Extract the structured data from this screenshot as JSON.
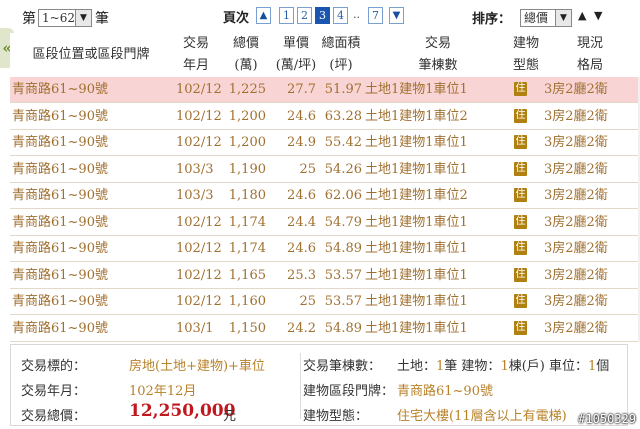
{
  "topbar": {
    "prefix": "第",
    "range_value": "1~62",
    "suffix": "筆",
    "page_label": "頁次",
    "pages": [
      "1",
      "2",
      "3",
      "4"
    ],
    "current_page": "3",
    "ellipsis": "..",
    "last_page": "7",
    "sort_label": "排序：",
    "sort_value": "總價"
  },
  "table": {
    "headers": {
      "location": "區段位置或區段門牌",
      "date_1": "交易",
      "date_2": "年月",
      "total_1": "總價",
      "total_2": "(萬)",
      "unit_1": "單價",
      "unit_2": "(萬/坪)",
      "area_1": "總面積",
      "area_2": "(坪)",
      "trans_1": "交易",
      "trans_2": "筆棟數",
      "btype_1": "建物",
      "btype_2": "型態",
      "layout_1": "現況",
      "layout_2": "格局"
    },
    "badge_text": "住",
    "rows": [
      {
        "loc": "青商路61~90號",
        "date": "102/12",
        "total": "1,225",
        "unit": "27.7",
        "area": "51.97",
        "trans": "土地1建物1車位1",
        "layout": "3房2廳2衛"
      },
      {
        "loc": "青商路61~90號",
        "date": "102/12",
        "total": "1,200",
        "unit": "24.6",
        "area": "63.28",
        "trans": "土地1建物1車位2",
        "layout": "3房2廳2衛"
      },
      {
        "loc": "青商路61~90號",
        "date": "102/12",
        "total": "1,200",
        "unit": "24.9",
        "area": "55.42",
        "trans": "土地1建物1車位1",
        "layout": "3房2廳2衛"
      },
      {
        "loc": "青商路61~90號",
        "date": "103/3",
        "total": "1,190",
        "unit": "25",
        "area": "54.26",
        "trans": "土地1建物1車位1",
        "layout": "3房2廳2衛"
      },
      {
        "loc": "青商路61~90號",
        "date": "103/3",
        "total": "1,180",
        "unit": "24.6",
        "area": "62.06",
        "trans": "土地1建物1車位2",
        "layout": "3房2廳2衛"
      },
      {
        "loc": "青商路61~90號",
        "date": "102/12",
        "total": "1,174",
        "unit": "24.4",
        "area": "54.79",
        "trans": "土地1建物1車位1",
        "layout": "3房2廳2衛"
      },
      {
        "loc": "青商路61~90號",
        "date": "102/12",
        "total": "1,174",
        "unit": "24.6",
        "area": "54.89",
        "trans": "土地1建物1車位1",
        "layout": "3房2廳2衛"
      },
      {
        "loc": "青商路61~90號",
        "date": "102/12",
        "total": "1,165",
        "unit": "25.3",
        "area": "53.57",
        "trans": "土地1建物1車位1",
        "layout": "3房2廳2衛"
      },
      {
        "loc": "青商路61~90號",
        "date": "102/12",
        "total": "1,160",
        "unit": "25",
        "area": "53.57",
        "trans": "土地1建物1車位1",
        "layout": "3房2廳2衛"
      },
      {
        "loc": "青商路61~90號",
        "date": "103/1",
        "total": "1,150",
        "unit": "24.2",
        "area": "54.89",
        "trans": "土地1建物1車位1",
        "layout": "3房2廳2衛"
      }
    ]
  },
  "detail": {
    "target_label": "交易標的：",
    "target_value": "房地(土地+建物)+車位",
    "date_label": "交易年月：",
    "date_value": "102年12月",
    "total_label": "交易總價：",
    "total_value": "12,250,000",
    "total_unit": "元",
    "count_label": "交易筆棟數：",
    "count_land": "土地：",
    "count_land_n": "1",
    "count_land_u": "筆 建物：",
    "count_bldg_n": "1",
    "count_bldg_u": "棟(戶) 車位：",
    "count_park_n": "1",
    "count_park_u": "個",
    "addr_label": "建物區段門牌：",
    "addr_value": "青商路61~90號",
    "btype_label": "建物型態：",
    "btype_value": "住宅大樓(11層含以上有電梯)"
  },
  "watermark": "#1050329",
  "colors": {
    "highlight_row": "#f9d4d4",
    "cell_text": "#a07030",
    "price_red": "#c0181e",
    "page_active": "#1a56b0"
  }
}
